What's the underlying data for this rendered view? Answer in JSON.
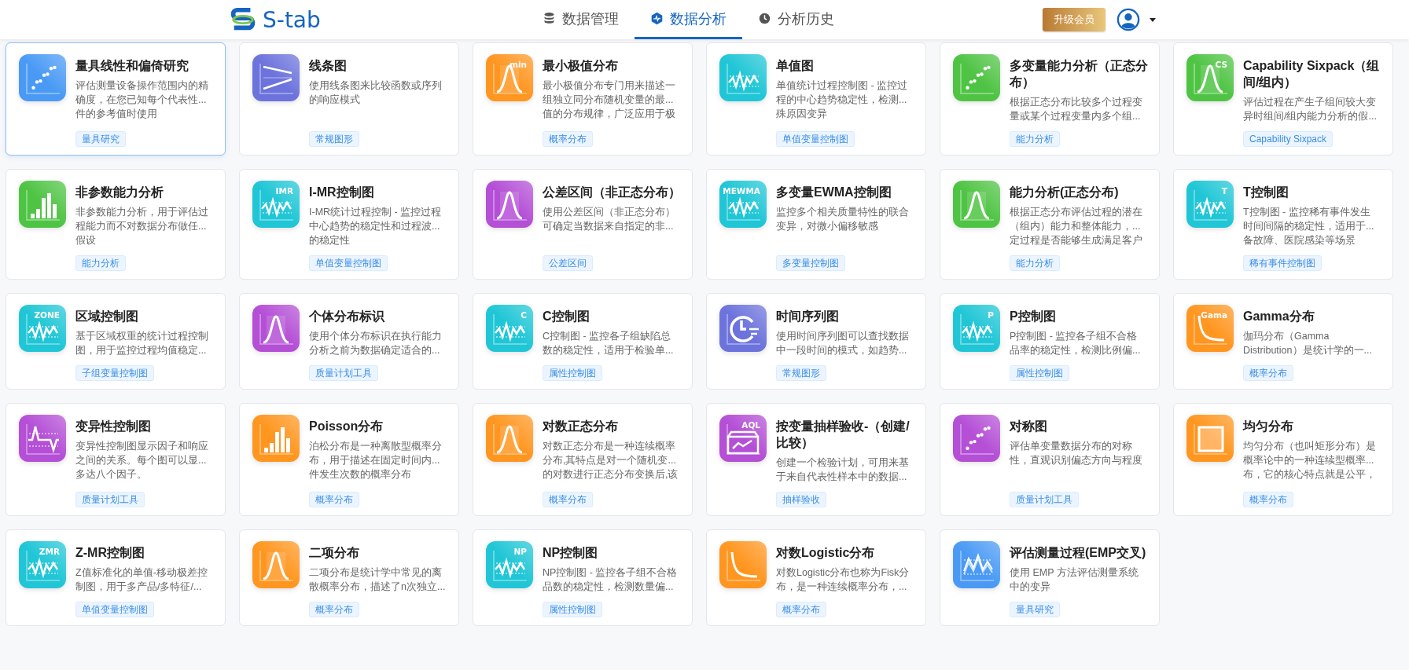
{
  "header": {
    "logo": "S-tab",
    "tabs": [
      {
        "label": "数据管理",
        "selected": false
      },
      {
        "label": "数据分析",
        "selected": true
      },
      {
        "label": "分析历史",
        "selected": false
      }
    ],
    "upgrade": "升级会员"
  },
  "cards": [
    {
      "title": "量具线性和偏倚研究",
      "desc": [
        "评估测量设备操作范围内的精",
        "确度，在您已知每个代表性...",
        "件的参考值时使用"
      ],
      "tag": "量具研究",
      "icon": {
        "kind": "scatter",
        "color": "#4a9af5"
      },
      "selected": true
    },
    {
      "title": "线条图",
      "desc": [
        "使用线条图来比较函数或序列",
        "的响应模式"
      ],
      "tag": "常规图形",
      "icon": {
        "kind": "lines",
        "color": "#6c73dc"
      },
      "selected": false
    },
    {
      "title": "最小极值分布",
      "desc": [
        "最小极值分布专门用来描述一",
        "组独立同分布随机变量的最...",
        "值的分布规律，广泛应用于极"
      ],
      "tag": "概率分布",
      "icon": {
        "kind": "curve",
        "color": "#ff9620",
        "text": "min"
      },
      "selected": false
    },
    {
      "title": "单值图",
      "desc": [
        "单值统计过程控制图 - 监控过",
        "程的中心趋势稳定性，检测...",
        "殊原因变异"
      ],
      "tag": "单值变量控制图",
      "icon": {
        "kind": "wave",
        "color": "#20c6d6"
      },
      "selected": false
    },
    {
      "title": "多变量能力分析（正态分布）",
      "desc": [
        "根据正态分布比较多个过程变",
        "量或某个过程变量内多个组..."
      ],
      "tag": "能力分析",
      "icon": {
        "kind": "scatter",
        "color": "#4fc444"
      },
      "selected": false
    },
    {
      "title": "Capability Sixpack（组间/组内）",
      "desc": [
        "评估过程在产生子组间较大变",
        "异时组间/组内能力分析的假..."
      ],
      "tag": "Capability Sixpack",
      "icon": {
        "kind": "curve",
        "color": "#4fc444",
        "text": "CS"
      },
      "selected": false
    },
    {
      "title": "非参数能力分析",
      "desc": [
        "非参数能力分析，用于评估过",
        "程能力而不对数据分布做任...",
        "假设"
      ],
      "tag": "能力分析",
      "icon": {
        "kind": "bars",
        "color": "#4fc444"
      },
      "selected": false
    },
    {
      "title": "I-MR控制图",
      "desc": [
        "I-MR统计过程控制 - 监控过程",
        "中心趋势的稳定性和过程波...",
        "的稳定性"
      ],
      "tag": "单值变量控制图",
      "icon": {
        "kind": "wave",
        "color": "#20c6d6",
        "text": "IMR"
      },
      "selected": false
    },
    {
      "title": "公差区间（非正态分布）",
      "desc": [
        "使用公差区间（非正态分布）",
        "可确定当数据来自指定的非..."
      ],
      "tag": "公差区间",
      "icon": {
        "kind": "curve",
        "color": "#b44fd6"
      },
      "selected": false
    },
    {
      "title": "多变量EWMA控制图",
      "desc": [
        "监控多个相关质量特性的联合",
        "变异，对微小偏移敏感"
      ],
      "tag": "多变量控制图",
      "icon": {
        "kind": "wave",
        "color": "#20c6d6",
        "text": "MEWMA"
      },
      "selected": false
    },
    {
      "title": "能力分析(正态分布)",
      "desc": [
        "根据正态分布评估过程的潜在",
        "（组内）能力和整体能力，...",
        "定过程是否能够生成满足客户"
      ],
      "tag": "能力分析",
      "icon": {
        "kind": "curve",
        "color": "#4fc444"
      },
      "selected": false
    },
    {
      "title": "T控制图",
      "desc": [
        "T控制图 - 监控稀有事件发生",
        "时间间隔的稳定性，适用于...",
        "备故障、医院感染等场景"
      ],
      "tag": "稀有事件控制图",
      "icon": {
        "kind": "wave",
        "color": "#20c6d6",
        "text": "T"
      },
      "selected": false
    },
    {
      "title": "区域控制图",
      "desc": [
        "基于区域权重的统计过程控制",
        "图，用于监控过程均值稳定..."
      ],
      "tag": "子组变量控制图",
      "icon": {
        "kind": "wave",
        "color": "#20c6d6",
        "text": "ZONE"
      },
      "selected": false
    },
    {
      "title": "个体分布标识",
      "desc": [
        "使用个体分布标识在执行能力",
        "分析之前为数据确定适合的..."
      ],
      "tag": "质量计划工具",
      "icon": {
        "kind": "curve",
        "color": "#b44fd6"
      },
      "selected": false
    },
    {
      "title": "C控制图",
      "desc": [
        "C控制图 - 监控各子组缺陷总",
        "数的稳定性，适用于检验单..."
      ],
      "tag": "属性控制图",
      "icon": {
        "kind": "wave",
        "color": "#20c6d6",
        "text": "C"
      },
      "selected": false
    },
    {
      "title": "时间序列图",
      "desc": [
        "使用时间序列图可以查找数据",
        "中一段时间的模式，如趋势..."
      ],
      "tag": "常规图形",
      "icon": {
        "kind": "clock",
        "color": "#6c73dc"
      },
      "selected": false
    },
    {
      "title": "P控制图",
      "desc": [
        "P控制图 - 监控各子组不合格",
        "品率的稳定性，检测比例偏..."
      ],
      "tag": "属性控制图",
      "icon": {
        "kind": "wave",
        "color": "#20c6d6",
        "text": "P"
      },
      "selected": false
    },
    {
      "title": "Gamma分布",
      "desc": [
        "伽玛分布（Gamma",
        "Distribution）是统计学的一..."
      ],
      "tag": "概率分布",
      "icon": {
        "kind": "decay",
        "color": "#ff9620",
        "text": "Gama"
      },
      "selected": false
    },
    {
      "title": "变异性控制图",
      "desc": [
        "变异性控制图显示因子和响应",
        "之间的关系。每个图可以显...",
        "多达八个因子。"
      ],
      "tag": "质量计划工具",
      "icon": {
        "kind": "spike",
        "color": "#b44fd6"
      },
      "selected": false
    },
    {
      "title": "Poisson分布",
      "desc": [
        "泊松分布是一种离散型概率分",
        "布，用于描述在固定时间内...",
        "件发生次数的概率分布"
      ],
      "tag": "概率分布",
      "icon": {
        "kind": "bars",
        "color": "#ff9620"
      },
      "selected": false
    },
    {
      "title": "对数正态分布",
      "desc": [
        "对数正态分布是一种连续概率",
        "分布,其特点是对一个随机变...",
        "的对数进行正态分布变换后,该"
      ],
      "tag": "概率分布",
      "icon": {
        "kind": "curve",
        "color": "#ff9620"
      },
      "selected": false
    },
    {
      "title": "按变量抽样验收-（创建/比较）",
      "desc": [
        "创建一个检验计划，可用来基",
        "于来自代表性样本中的数据..."
      ],
      "tag": "抽样验收",
      "icon": {
        "kind": "box",
        "color": "#b44fd6",
        "text": "AQL"
      },
      "selected": false
    },
    {
      "title": "对称图",
      "desc": [
        "评估单变量数据分布的对称",
        "性，直观识别偏态方向与程度"
      ],
      "tag": "质量计划工具",
      "icon": {
        "kind": "scatter",
        "color": "#b44fd6"
      },
      "selected": false
    },
    {
      "title": "均匀分布",
      "desc": [
        "均匀分布（也叫矩形分布）是",
        "概率论中的一种连续型概率...",
        "布，它的核心特点就是公平，"
      ],
      "tag": "概率分布",
      "icon": {
        "kind": "square",
        "color": "#ff9620"
      },
      "selected": false
    },
    {
      "title": "Z-MR控制图",
      "desc": [
        "Z值标准化的单值-移动极差控",
        "制图，用于多产品/多特征/..."
      ],
      "tag": "单值变量控制图",
      "icon": {
        "kind": "wave",
        "color": "#20c6d6",
        "text": "ZMR"
      },
      "selected": false
    },
    {
      "title": "二项分布",
      "desc": [
        "二项分布是统计学中常见的离",
        "散概率分布，描述了n次独立..."
      ],
      "tag": "概率分布",
      "icon": {
        "kind": "curve",
        "color": "#ff9620"
      },
      "selected": false
    },
    {
      "title": "NP控制图",
      "desc": [
        "NP控制图 - 监控各子组不合格",
        "品数的稳定性，检测数量偏..."
      ],
      "tag": "属性控制图",
      "icon": {
        "kind": "wave",
        "color": "#20c6d6",
        "text": "NP"
      },
      "selected": false
    },
    {
      "title": "对数Logistic分布",
      "desc": [
        "对数Logistic分布也称为Fisk分",
        "布，是一种连续概率分布，..."
      ],
      "tag": "概率分布",
      "icon": {
        "kind": "decay",
        "color": "#ff9620"
      },
      "selected": false
    },
    {
      "title": "评估测量过程(EMP交叉)",
      "desc": [
        "使用 EMP 方法评估测量系统",
        "中的变异"
      ],
      "tag": "量具研究",
      "icon": {
        "kind": "multiwave",
        "color": "#4a9af5"
      },
      "selected": false
    }
  ]
}
